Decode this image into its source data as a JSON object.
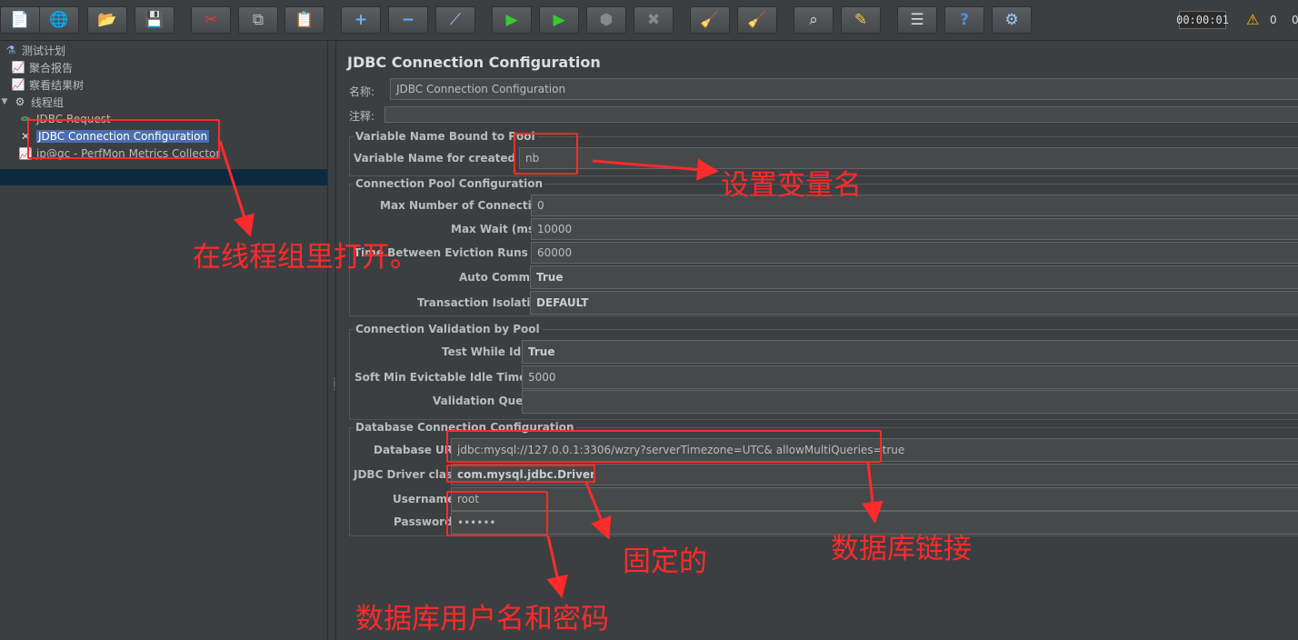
{
  "toolbar": {
    "buttons": [
      "new-icon",
      "templates-icon",
      "open-icon",
      "save-icon",
      "cut-icon",
      "copy-icon",
      "paste-icon",
      "expand-icon",
      "collapse-icon",
      "toggle-icon",
      "start-icon",
      "start-no-pause-icon",
      "stop-icon",
      "shutdown-icon",
      "clear-icon",
      "clear-all-icon",
      "search-icon",
      "reset-search-icon",
      "function-helper-icon",
      "help-icon",
      "remote-icon"
    ],
    "timer": "00:00:01",
    "warnings": "0",
    "errors": "0"
  },
  "tree": {
    "items": [
      {
        "label": "测试计划",
        "icon": "flask-icon"
      },
      {
        "label": "聚合报告",
        "icon": "chart-icon"
      },
      {
        "label": "察看结果树",
        "icon": "chart-icon"
      },
      {
        "label": "线程组",
        "icon": "gear-icon"
      },
      {
        "label": "JDBC Request",
        "icon": "pencil-icon"
      },
      {
        "label": "JDBC Connection Configuration",
        "icon": "wrench-icon"
      },
      {
        "label": "jp@gc - PerfMon Metrics Collector",
        "icon": "chart-icon"
      }
    ]
  },
  "main": {
    "title": "JDBC Connection Configuration",
    "name_label": "名称:",
    "name_value": "JDBC Connection Configuration",
    "comment_label": "注释:",
    "comment_value": "",
    "sec_var": "Variable Name Bound to Pool",
    "var_label": "Variable Name for created pool",
    "var_value": "nb",
    "sec_pool": "Connection Pool Configuration",
    "max_conn_label": "Max Number of Connections:",
    "max_conn_value": "0",
    "max_wait_label": "Max Wait (ms):",
    "max_wait_value": "10000",
    "evict_label": "Time Between Eviction Runs (ms):",
    "evict_value": "60000",
    "auto_commit_label": "Auto Commit:",
    "auto_commit_value": "True",
    "isolation_label": "Transaction Isolation:",
    "isolation_value": "DEFAULT",
    "sec_valid": "Connection Validation by Pool",
    "test_idle_label": "Test While Idle:",
    "test_idle_value": "True",
    "soft_min_label": "Soft Min Evictable Idle Time(ms):",
    "soft_min_value": "5000",
    "valid_query_label": "Validation Query:",
    "valid_query_value": "",
    "sec_db": "Database Connection Configuration",
    "db_url_label": "Database URL:",
    "db_url_value": "jdbc:mysql://127.0.0.1:3306/wzry?serverTimezone=UTC& allowMultiQueries=true",
    "driver_label": "JDBC Driver class:",
    "driver_value": "com.mysql.jdbc.Driver",
    "username_label": "Username",
    "username_value": "root",
    "password_label": "Password",
    "password_value": "••••••"
  },
  "annotations": {
    "open_in_group": "在线程组里打开。",
    "set_var_name": "设置变量名",
    "fixed": "固定的",
    "db_link": "数据库链接",
    "db_user_pass": "数据库用户名和密码",
    "color": "#ff2a2a"
  }
}
